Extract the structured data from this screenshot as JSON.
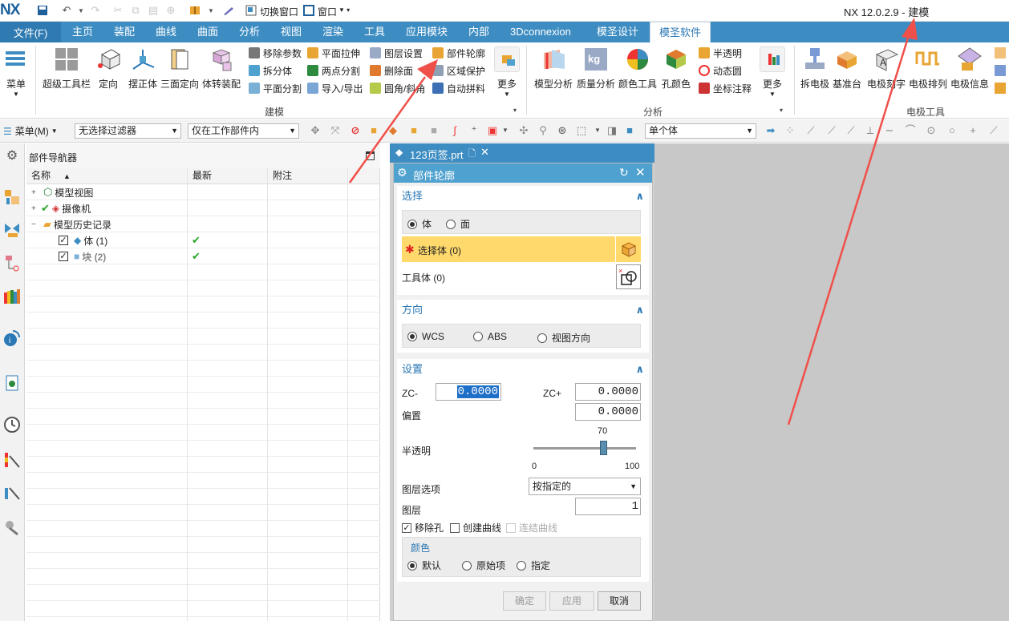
{
  "titlebar": {
    "logo": "NX",
    "switch_window": "切换窗口",
    "window_menu": "窗口",
    "app_title": "NX 12.0.2.9 - 建模"
  },
  "menubar": {
    "file": "文件(F)",
    "tabs": [
      "主页",
      "装配",
      "曲线",
      "曲面",
      "分析",
      "视图",
      "渲染",
      "工具",
      "应用模块",
      "内部",
      "3Dconnexion",
      "模圣设计",
      "模圣软件"
    ],
    "active_tab": "模圣软件"
  },
  "ribbon": {
    "menu_btn": "菜单",
    "big_buttons": [
      "超级工具栏",
      "定向",
      "摆正体",
      "三面定向",
      "体转装配"
    ],
    "small_col1": [
      "移除参数",
      "拆分体",
      "平面分割"
    ],
    "small_col2": [
      "平面拉伸",
      "两点分割",
      "导入/导出"
    ],
    "small_col3": [
      "图层设置",
      "删除面",
      "圆角/斜角"
    ],
    "small_col4": [
      "部件轮廓",
      "区域保护",
      "自动拼料"
    ],
    "more1": "更多",
    "group1_label": "建模",
    "analysis_big": [
      "模型分析",
      "质量分析",
      "颜色工具",
      "孔颜色"
    ],
    "small_col5": [
      "半透明",
      "动态圆",
      "坐标注释"
    ],
    "more2": "更多",
    "group2_label": "分析",
    "electrode_big": [
      "拆电极",
      "基准台",
      "电极刻字",
      "电极排列",
      "电极信息"
    ],
    "group3_label": "电极工具"
  },
  "toolbar2": {
    "menu_label": "菜单(M)",
    "filter": "无选择过滤器",
    "scope": "仅在工作部件内",
    "body_select": "单个体"
  },
  "navigator": {
    "title": "部件导航器",
    "columns": [
      "名称",
      "最新",
      "附注"
    ],
    "items": [
      {
        "label": "模型视图",
        "latest": ""
      },
      {
        "label": "摄像机",
        "latest": ""
      },
      {
        "label": "模型历史记录",
        "latest": ""
      },
      {
        "label": "体 (1)",
        "latest": "✔"
      },
      {
        "label": "块 (2)",
        "latest": "✔"
      }
    ]
  },
  "tab": {
    "filename": "123页签.prt"
  },
  "dialog": {
    "title": "部件轮廓",
    "select": {
      "header": "选择",
      "mode_options": [
        "体",
        "面"
      ],
      "mode_selected": "体",
      "select_body": "选择体 (0)",
      "tool_body": "工具体 (0)"
    },
    "direction": {
      "header": "方向",
      "options": [
        "WCS",
        "ABS",
        "视图方向"
      ],
      "selected": "WCS"
    },
    "settings": {
      "header": "设置",
      "zc_minus_label": "ZC-",
      "zc_minus": "0.0000",
      "zc_plus_label": "ZC+",
      "zc_plus": "0.0000",
      "offset_label": "偏置",
      "offset": "0.0000",
      "transparency_label": "半透明",
      "transparency_value": "70",
      "transparency_min": "0",
      "transparency_max": "100",
      "transparency_fraction": 0.7,
      "layer_option_label": "图层选项",
      "layer_option": "按指定的",
      "layer_label": "图层",
      "layer": "1",
      "remove_holes": "移除孔",
      "create_curves": "创建曲线",
      "connect_curves": "连结曲线",
      "color_header": "颜色",
      "color_options": [
        "默认",
        "原始项",
        "指定"
      ],
      "color_selected": "默认"
    },
    "buttons": {
      "ok": "确定",
      "apply": "应用",
      "cancel": "取消"
    }
  },
  "colors": {
    "ribbon_blue": "#3d8dc2",
    "dialog_title": "#4fa1cf",
    "highlight_yellow": "#ffd96b",
    "arrow_red": "#f0504a",
    "viewport_gray": "#c8c8c8"
  }
}
